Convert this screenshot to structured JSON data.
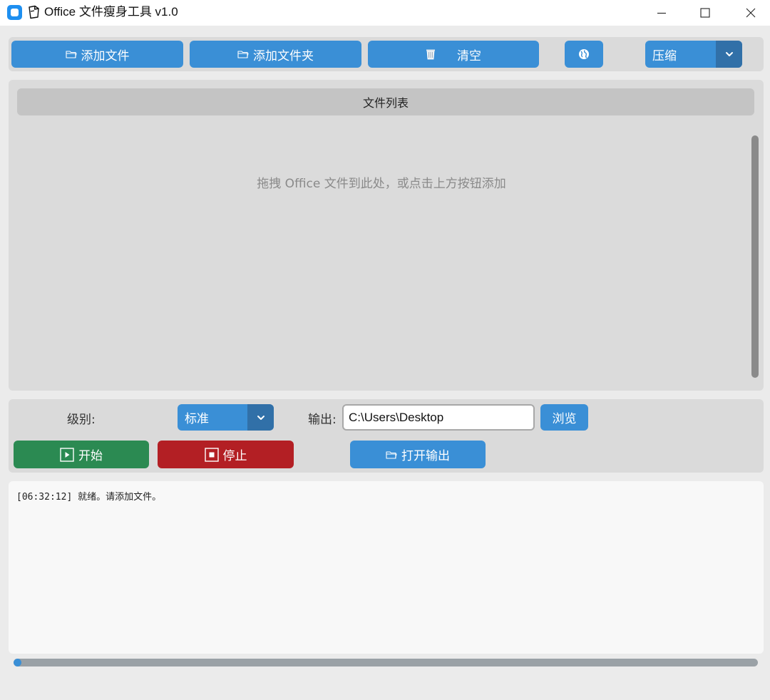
{
  "window": {
    "title": "Office 文件瘦身工具 v1.0"
  },
  "toolbar": {
    "add_file_label": "添加文件",
    "add_folder_label": "添加文件夹",
    "clear_label": "清空",
    "mode_selected": "压缩"
  },
  "file_list": {
    "header": "文件列表",
    "empty_hint": "拖拽 Office 文件到此处，或点击上方按钮添加"
  },
  "settings": {
    "level_label": "级别:",
    "level_selected": "标准",
    "output_label": "输出:",
    "output_path": "C:\\Users\\Desktop",
    "browse_label": "浏览",
    "start_label": "开始",
    "stop_label": "停止",
    "open_output_label": "打开输出"
  },
  "log": {
    "lines": [
      {
        "time": "[06:32:12]",
        "message": "就绪。请添加文件。"
      }
    ]
  },
  "progress": {
    "value": 0
  },
  "colors": {
    "primary_button": "#3a8fd6",
    "dropdown_arrow_bg": "#3170a8",
    "start_button": "#2b8a52",
    "stop_button": "#b31f24"
  },
  "icons": {
    "app": "app-icon",
    "document": "document-icon",
    "folder": "folder-icon",
    "trash": "trash-icon",
    "globe": "globe-icon",
    "chevron": "chevron-down-icon",
    "play": "play-icon",
    "stop": "stop-icon"
  }
}
